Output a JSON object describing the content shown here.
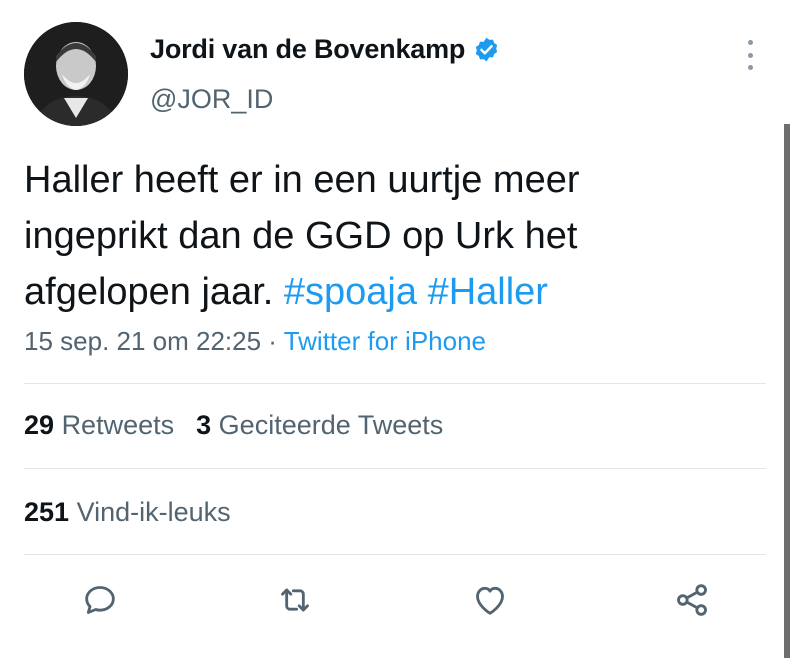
{
  "author": {
    "display_name": "Jordi van de Bovenkamp",
    "handle": "@JOR_ID",
    "verified": true
  },
  "tweet": {
    "line1": "Haller heeft er in een uurtje meer",
    "line2": "ingeprikt dan de GGD op Urk het",
    "line3_text": "afgelopen jaar. ",
    "hashtag1": "#spoaja",
    "hashtag2": "#Haller"
  },
  "meta": {
    "timestamp": "15 sep. 21 om 22:25",
    "separator": " · ",
    "source": "Twitter for iPhone"
  },
  "stats": {
    "retweets_count": "29",
    "retweets_label": "Retweets",
    "quotes_count": "3",
    "quotes_label": "Geciteerde Tweets",
    "likes_count": "251",
    "likes_label": "Vind-ik-leuks"
  },
  "icons": {
    "reply": "reply-icon",
    "retweet": "retweet-icon",
    "like": "heart-icon",
    "share": "share-icon",
    "more": "more-vertical-icon",
    "verified": "verified-badge-icon"
  },
  "colors": {
    "link": "#1d9bf0",
    "secondary_text": "#536471",
    "primary_text": "#0f1419",
    "icon": "#536471"
  }
}
